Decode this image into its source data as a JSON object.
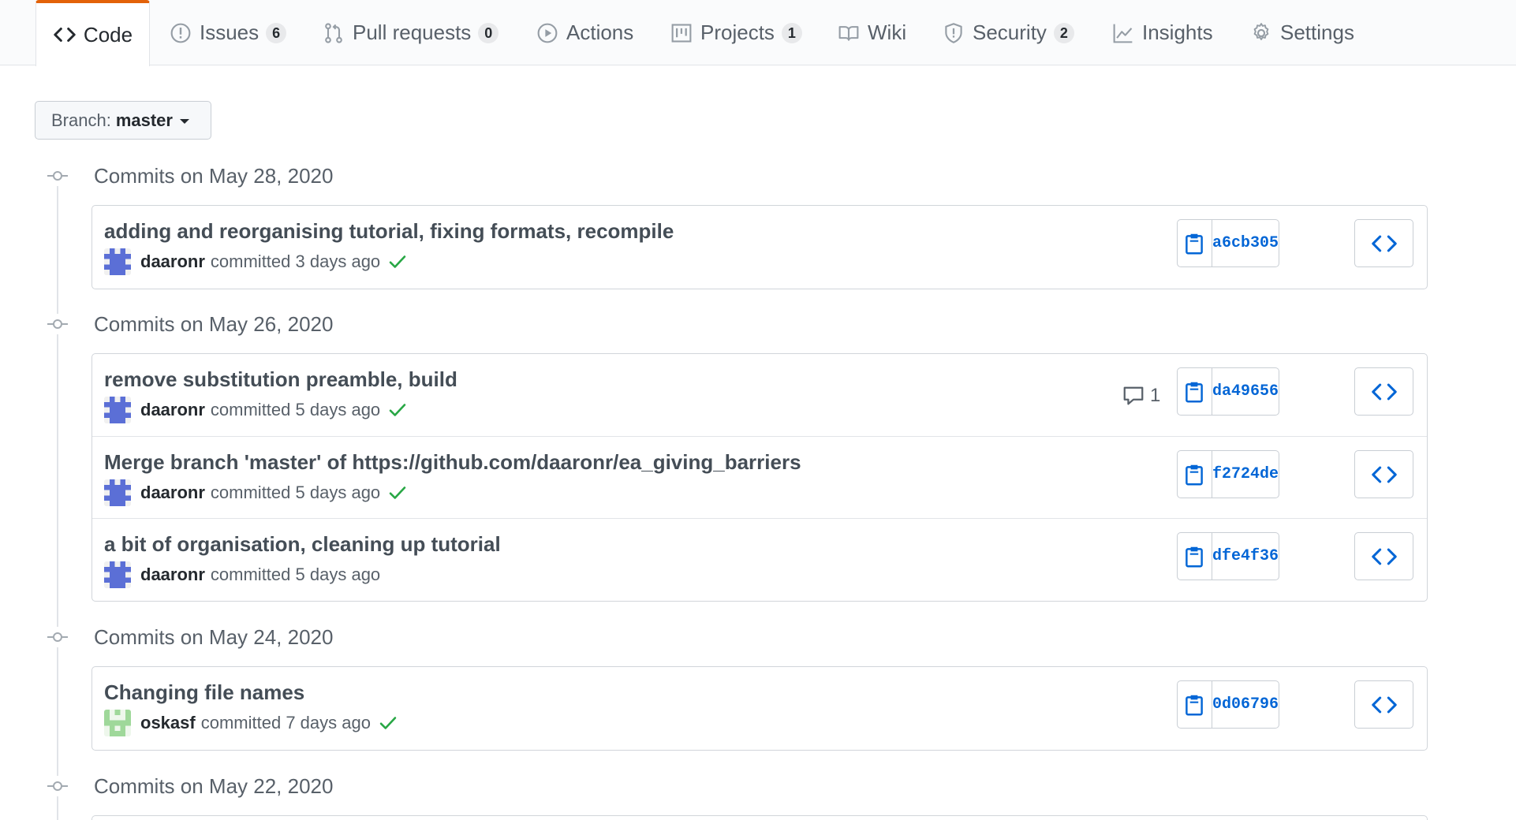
{
  "colors": {
    "accent_tab": "#e36209",
    "link": "#0366d6",
    "check": "#28a745"
  },
  "tabs": [
    {
      "label": "Code",
      "icon": "code-icon",
      "counter": null,
      "selected": true
    },
    {
      "label": "Issues",
      "icon": "issue-icon",
      "counter": "6"
    },
    {
      "label": "Pull requests",
      "icon": "pull-request-icon",
      "counter": "0"
    },
    {
      "label": "Actions",
      "icon": "play-icon",
      "counter": null
    },
    {
      "label": "Projects",
      "icon": "project-icon",
      "counter": "1"
    },
    {
      "label": "Wiki",
      "icon": "book-icon",
      "counter": null
    },
    {
      "label": "Security",
      "icon": "shield-icon",
      "counter": "2"
    },
    {
      "label": "Insights",
      "icon": "graph-icon",
      "counter": null
    },
    {
      "label": "Settings",
      "icon": "gear-icon",
      "counter": null
    }
  ],
  "branch": {
    "label": "Branch:",
    "value": "master"
  },
  "groups": [
    {
      "date_label": "Commits on May 28, 2020",
      "commits": [
        {
          "message": "adding and reorganising tutorial, fixing formats, recompile",
          "author": "daaronr",
          "verb": "committed",
          "time": "3 days ago",
          "checked": true,
          "sha": "a6cb305",
          "comments": null,
          "avatar": "daaronr"
        }
      ]
    },
    {
      "date_label": "Commits on May 26, 2020",
      "commits": [
        {
          "message": "remove substitution preamble, build",
          "author": "daaronr",
          "verb": "committed",
          "time": "5 days ago",
          "checked": true,
          "sha": "da49656",
          "comments": "1",
          "avatar": "daaronr"
        },
        {
          "message": "Merge branch 'master' of https://github.com/daaronr/ea_giving_barriers",
          "author": "daaronr",
          "verb": "committed",
          "time": "5 days ago",
          "checked": true,
          "sha": "f2724de",
          "comments": null,
          "avatar": "daaronr"
        },
        {
          "message": "a bit of organisation, cleaning up tutorial",
          "author": "daaronr",
          "verb": "committed",
          "time": "5 days ago",
          "checked": false,
          "sha": "dfe4f36",
          "comments": null,
          "avatar": "daaronr"
        }
      ]
    },
    {
      "date_label": "Commits on May 24, 2020",
      "commits": [
        {
          "message": "Changing file names",
          "author": "oskasf",
          "verb": "committed",
          "time": "7 days ago",
          "checked": true,
          "sha": "0d06796",
          "comments": null,
          "avatar": "oskasf"
        }
      ]
    },
    {
      "date_label": "Commits on May 22, 2020",
      "commits": []
    }
  ]
}
